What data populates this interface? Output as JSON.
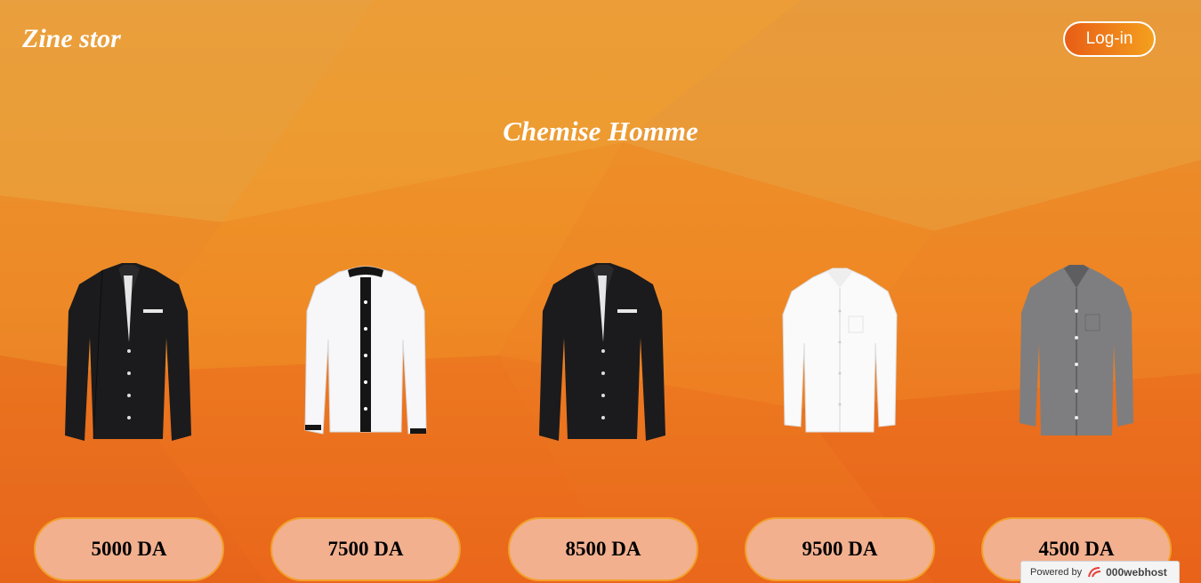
{
  "header": {
    "brand": "Zine stor",
    "login_label": "Log-in"
  },
  "main": {
    "title": "Chemise Homme",
    "products": [
      {
        "price": "5000 DA",
        "image": "black-shirt"
      },
      {
        "price": "7500 DA",
        "image": "white-shirt-black-placket"
      },
      {
        "price": "8500 DA",
        "image": "black-shirt"
      },
      {
        "price": "9500 DA",
        "image": "white-shirt"
      },
      {
        "price": "4500 DA",
        "image": "gray-shirt"
      }
    ]
  },
  "footer": {
    "powered_by": "Powered by",
    "host": "000webhost"
  },
  "colors": {
    "background": "#ee8a26",
    "price_pill": "#f2b08f",
    "text": "#ffffff"
  }
}
